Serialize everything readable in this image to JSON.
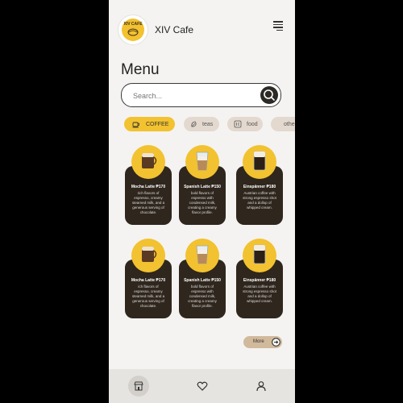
{
  "header": {
    "logo_text": "XIV CAFE",
    "title": "XIV Cafe",
    "menu_icon": "hamburger-icon"
  },
  "page_title": "Menu",
  "search": {
    "placeholder": "Search...",
    "icon": "search-icon"
  },
  "categories": [
    {
      "label": "COFFEE",
      "icon": "coffee-cup-icon",
      "active": true
    },
    {
      "label": "teas",
      "icon": "tea-leaf-icon",
      "active": false
    },
    {
      "label": "food",
      "icon": "food-icon",
      "active": false
    },
    {
      "label": "other",
      "icon": "",
      "active": false
    }
  ],
  "products": [
    {
      "name": "Mocha Latte ₱170",
      "desc": [
        "rich flavors of",
        "espresso, creamy",
        "steamed milk, and a",
        "generous serving of",
        "chocolate."
      ],
      "image": "mocha-latte-image"
    },
    {
      "name": "Spanish Latte ₱150",
      "desc": [
        "bold flavors of",
        "espresso with",
        "condensed milk,",
        "creating a creamy",
        "flavor profile."
      ],
      "image": "spanish-latte-image"
    },
    {
      "name": "Einspänner ₱180",
      "desc": [
        "Austrian coffee with",
        "strong espresso shot",
        "and a dollop of",
        "whipped cream."
      ],
      "image": "einspanner-image"
    },
    {
      "name": "Mocha Latte ₱170",
      "desc": [
        "ich flavors of",
        "espresso, creamy",
        "steamed milk, and a",
        "generous serving of",
        "chocolate."
      ],
      "image": "mocha-latte-image"
    },
    {
      "name": "Spanish Latte ₱150",
      "desc": [
        "bold flavors of",
        "espresso with",
        "condensed milk,",
        "creating a creamy",
        "flavor profile."
      ],
      "image": "spanish-latte-image"
    },
    {
      "name": "Einspänner ₱180",
      "desc": [
        "Austrian coffee with",
        "strong espresso shot",
        "and a dollop of",
        "whipped cream."
      ],
      "image": "einspanner-image"
    }
  ],
  "more_button": {
    "label": "More",
    "icon": "arrow-right-circle-icon"
  },
  "bottom_nav": [
    {
      "icon": "store-icon",
      "active": true
    },
    {
      "icon": "heart-icon",
      "active": false
    },
    {
      "icon": "user-icon",
      "active": false
    }
  ],
  "colors": {
    "accent": "#f2c230",
    "card": "#2f261d",
    "background": "#f4f3f1",
    "chip": "#e3d9cf"
  }
}
